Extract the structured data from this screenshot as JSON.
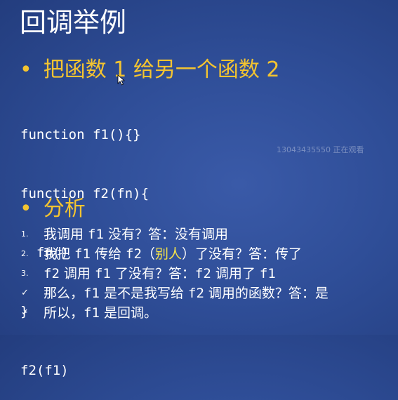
{
  "title": "回调举例",
  "heading1": "把函数 1 给另一个函数 2",
  "code_lines": [
    "function f1(){}",
    "function f2(fn){",
    "  fn()",
    "}",
    "f2(f1)"
  ],
  "viewer_note": "13043435550 正在观看",
  "heading2": "分析",
  "analysis": [
    {
      "marker": "1.",
      "parts": [
        "我调用 ",
        "f1",
        " 没有？答：没有调用"
      ]
    },
    {
      "marker": "2.",
      "parts": [
        "我把 ",
        "f1",
        " 传给 ",
        "f2",
        "（",
        "别人",
        "）了没有？答：传了"
      ]
    },
    {
      "marker": "3.",
      "parts": [
        "f2",
        " 调用 ",
        "f1",
        " 了没有？答：",
        "f2",
        " 调用了 ",
        "f1"
      ]
    },
    {
      "marker": "✓",
      "parts": [
        "那么，",
        "f1",
        " 是不是我写给 ",
        "f2",
        " 调用的函数？答：是"
      ]
    },
    {
      "marker": "✓",
      "parts": [
        "所以，",
        "f1",
        " 是回调。"
      ]
    }
  ],
  "colors": {
    "background": "#2f4e98",
    "heading": "#f4c430",
    "highlight": "#f4e24a",
    "text": "#ffffff"
  },
  "icons": {
    "bullet": "bullet-dot",
    "cursor": "mouse-pointer-icon",
    "check": "checkmark"
  }
}
